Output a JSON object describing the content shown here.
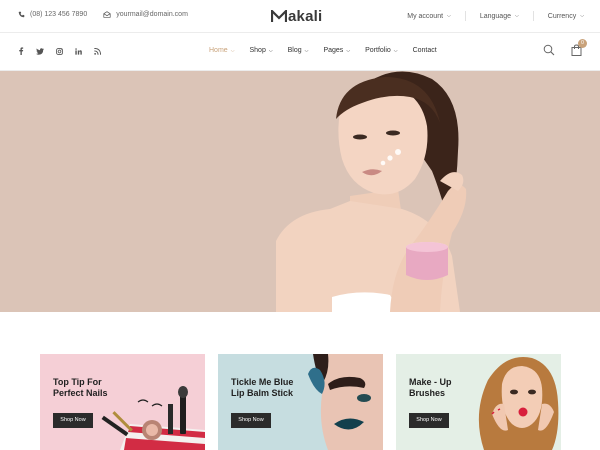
{
  "topbar": {
    "phone": "(08) 123 456 7890",
    "email": "yourmail@domain.com",
    "logo": "akali",
    "my_account": "My account",
    "language": "Language",
    "currency": "Currency"
  },
  "nav": {
    "items": [
      {
        "label": "Home",
        "dropdown": true,
        "active": true
      },
      {
        "label": "Shop",
        "dropdown": true
      },
      {
        "label": "Blog",
        "dropdown": true
      },
      {
        "label": "Pages",
        "dropdown": true
      },
      {
        "label": "Portfolio",
        "dropdown": true
      },
      {
        "label": "Contact",
        "dropdown": false
      }
    ],
    "cart_count": "0"
  },
  "banners": [
    {
      "title_line1": "Top Tip For",
      "title_line2": "Perfect Nails",
      "button": "Shop Now",
      "bg": "#f5cfd6"
    },
    {
      "title_line1": "Tickle Me Blue",
      "title_line2": "Lip Balm Stick",
      "button": "Shop Now",
      "bg": "#c6dde0"
    },
    {
      "title_line1": "Make - Up",
      "title_line2": "Brushes",
      "button": "Shop Now",
      "bg": "#e4efe6"
    }
  ],
  "colors": {
    "accent": "#c9a27a",
    "hero_bg": "#dbc4b7",
    "dark": "#2b2b2b"
  }
}
